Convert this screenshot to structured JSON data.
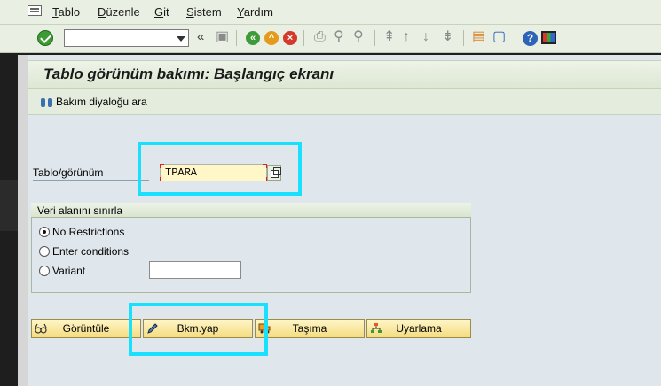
{
  "menubar": {
    "items": [
      {
        "label": "Tablo",
        "accel": "T",
        "rest": "ablo"
      },
      {
        "label": "Düzenle",
        "accel": "D",
        "rest": "üzenle"
      },
      {
        "label": "Git",
        "accel": "G",
        "rest": "it"
      },
      {
        "label": "Sistem",
        "accel": "S",
        "rest": "istem"
      },
      {
        "label": "Yardım",
        "accel": "Y",
        "rest": "ardım"
      }
    ]
  },
  "toolbar": {
    "command_field_value": "",
    "icons": [
      "ok-icon",
      "command-dropdown",
      "collapse-icon",
      "save-icon",
      "back-icon",
      "exit-icon",
      "cancel-icon",
      "print-icon",
      "find-icon",
      "find-next-icon",
      "first-page-icon",
      "prev-page-icon",
      "next-page-icon",
      "last-page-icon",
      "new-session-icon",
      "shortcut-icon",
      "help-icon",
      "layout-icon"
    ]
  },
  "page": {
    "title": "Tablo görünüm bakımı: Başlangıç ekranı",
    "app_toolbar_label": "Bakım diyaloğu ara"
  },
  "form": {
    "table_view_label": "Tablo/görünüm",
    "table_view_value": "TPARA"
  },
  "restrict_group": {
    "title": "Veri alanını sınırla",
    "options": [
      {
        "label": "No Restrictions",
        "selected": true
      },
      {
        "label": "Enter conditions",
        "selected": false
      },
      {
        "label": "Variant",
        "selected": false
      }
    ],
    "variant_value": ""
  },
  "actions": {
    "display": "Görüntüle",
    "maintain": "Bkm.yap",
    "transport": "Taşıma",
    "customize": "Uyarlama"
  }
}
